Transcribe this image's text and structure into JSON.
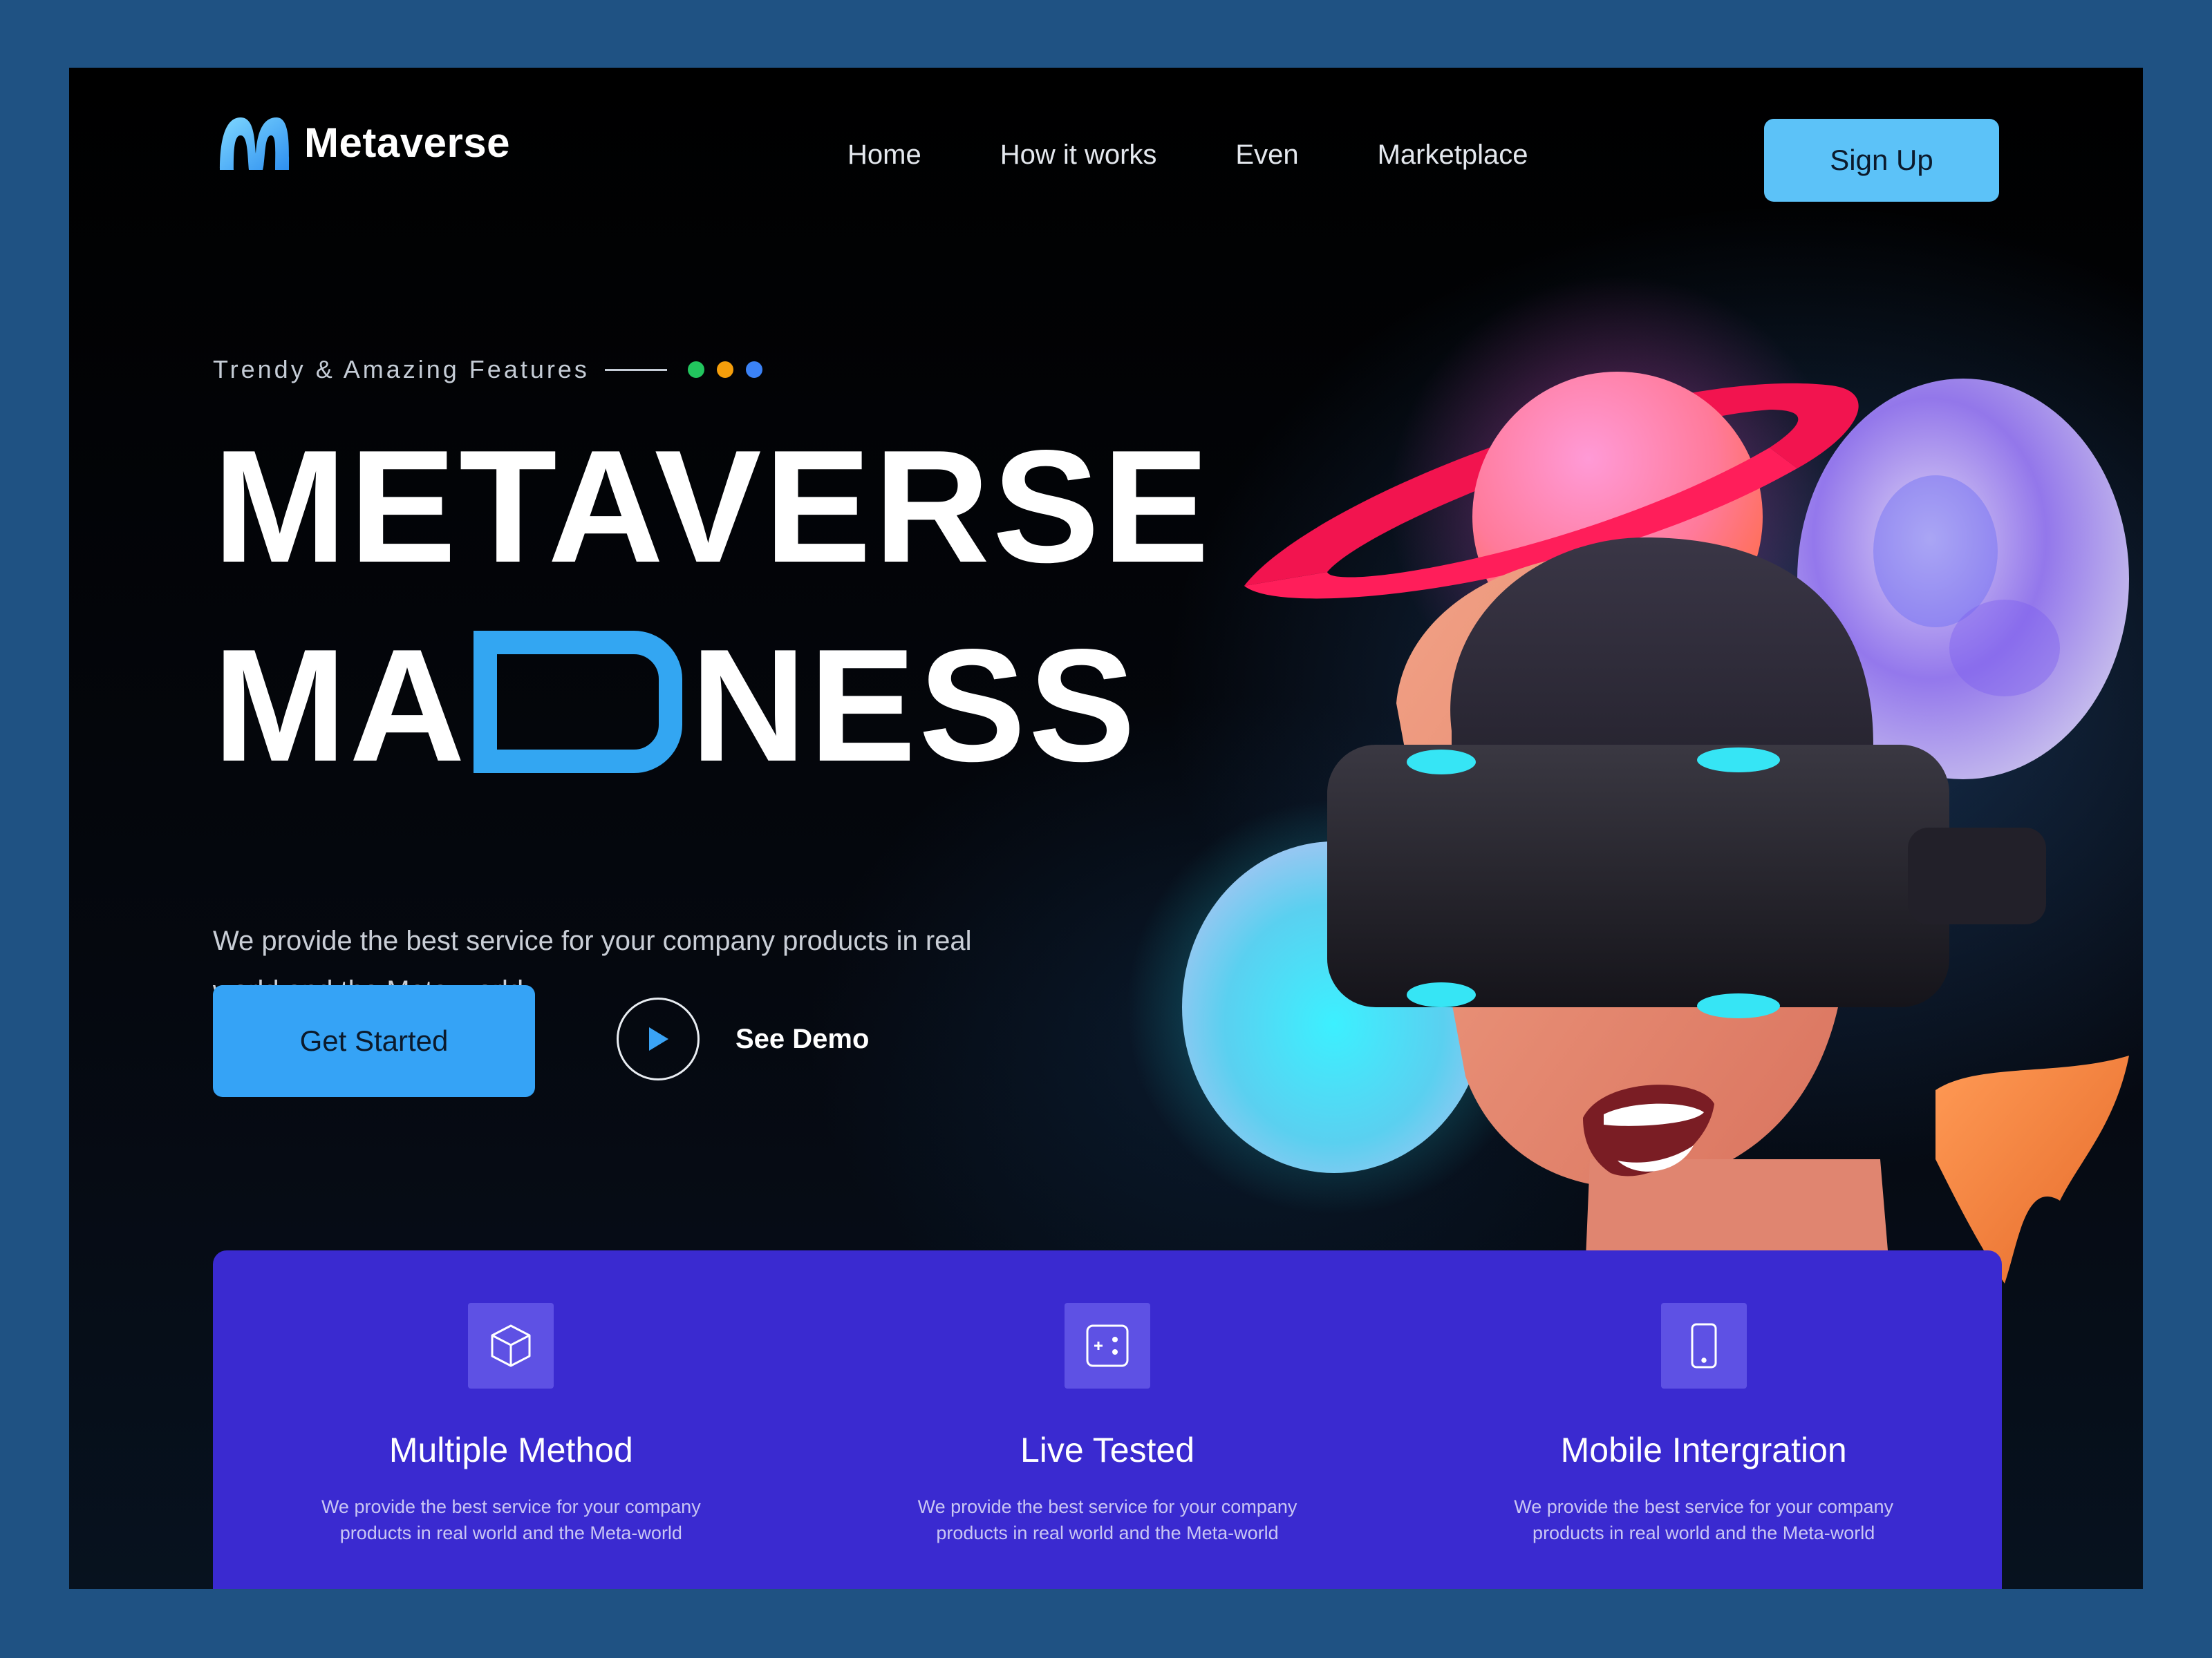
{
  "brand": {
    "name": "Metaverse",
    "logo_icon": "m-wave-logo-icon",
    "accent": "#35a3f6"
  },
  "nav": {
    "items": [
      {
        "label": "Home"
      },
      {
        "label": "How it works"
      },
      {
        "label": "Even"
      },
      {
        "label": "Marketplace"
      }
    ],
    "signup_label": "Sign Up"
  },
  "hero": {
    "eyebrow": "Trendy & Amazing Features",
    "eyebrow_dots": [
      "#22c55e",
      "#f59e0b",
      "#3b82f6"
    ],
    "headline_line1": "METAVERSE",
    "headline_line2_prefix": "MA",
    "headline_line2_suffix": "NESS",
    "subtext": "We provide the best service for your company products in real world and the Meta-world",
    "primary_cta": "Get Started",
    "secondary_cta": "See Demo",
    "secondary_icon": "play-icon"
  },
  "features": [
    {
      "icon": "cube-icon",
      "title": "Multiple Method",
      "desc": "We provide the best service for your company products in real world and the Meta-world"
    },
    {
      "icon": "dice-icon",
      "title": "Live Tested",
      "desc": "We provide the best service for your company products in real world and the Meta-world"
    },
    {
      "icon": "smartphone-icon",
      "title": "Mobile Intergration",
      "desc": "We provide the best service for your company products in real world and the Meta-world"
    }
  ],
  "colors": {
    "page_bg": "#1f5283",
    "features_bg": "#3a2ad0",
    "signup_bg": "#5cc2f8"
  }
}
